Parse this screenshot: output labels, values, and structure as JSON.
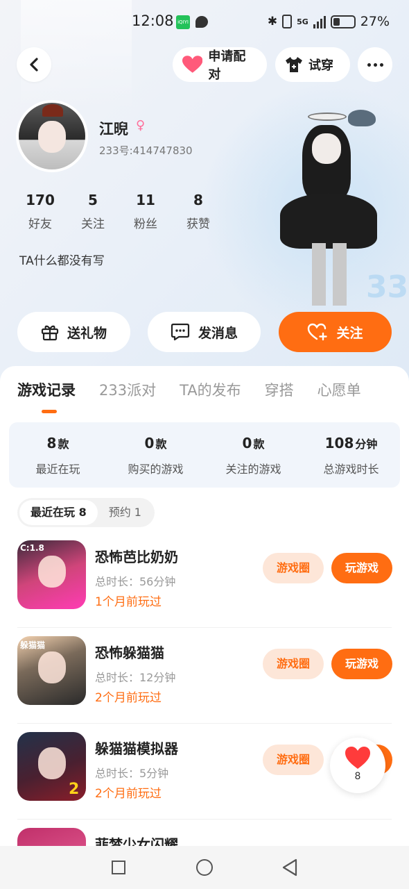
{
  "status_bar": {
    "time": "12:08",
    "app_icon_1": "iQIYI",
    "network": "5G",
    "battery": "27%"
  },
  "header": {
    "match_label": "申请配对",
    "try_label": "试穿"
  },
  "profile": {
    "name": "江晲",
    "gender": "female",
    "id": "233号:414747830",
    "bio": "TA什么都没有写",
    "stats": [
      {
        "num": "170",
        "label": "好友"
      },
      {
        "num": "5",
        "label": "关注"
      },
      {
        "num": "11",
        "label": "粉丝"
      },
      {
        "num": "8",
        "label": "获赞"
      }
    ]
  },
  "actions": {
    "gift": "送礼物",
    "message": "发消息",
    "follow": "关注"
  },
  "tabs": [
    "游戏记录",
    "233派对",
    "TA的发布",
    "穿搭",
    "心愿单"
  ],
  "summary": [
    {
      "value": "8",
      "unit": "款",
      "label": "最近在玩"
    },
    {
      "value": "0",
      "unit": "款",
      "label": "购买的游戏"
    },
    {
      "value": "0",
      "unit": "款",
      "label": "关注的游戏"
    },
    {
      "value": "108",
      "unit": "分钟",
      "label": "总游戏时长"
    }
  ],
  "subtabs": {
    "recent": "最近在玩 8",
    "reserve": "预约 1"
  },
  "games": [
    {
      "name": "恐怖芭比奶奶",
      "time": "总时长：56分钟",
      "last": "1个月前玩过",
      "tag": "C:1.8"
    },
    {
      "name": "恐怖躲猫猫",
      "time": "总时长：12分钟",
      "last": "2个月前玩过",
      "tag": "躲猫猫"
    },
    {
      "name": "躲猫猫模拟器",
      "time": "总时长：5分钟",
      "last": "2个月前玩过",
      "tag": "2"
    },
    {
      "name": "菲梦少女闪耀",
      "time": "",
      "last": "",
      "tag": ""
    }
  ],
  "game_buttons": {
    "circle": "游戏圈",
    "play": "玩游戏"
  },
  "like_fab": {
    "count": "8"
  },
  "colors": {
    "accent": "#ff6d12",
    "accent_soft": "#fde6d8",
    "gender_female": "#ff6e9a"
  }
}
